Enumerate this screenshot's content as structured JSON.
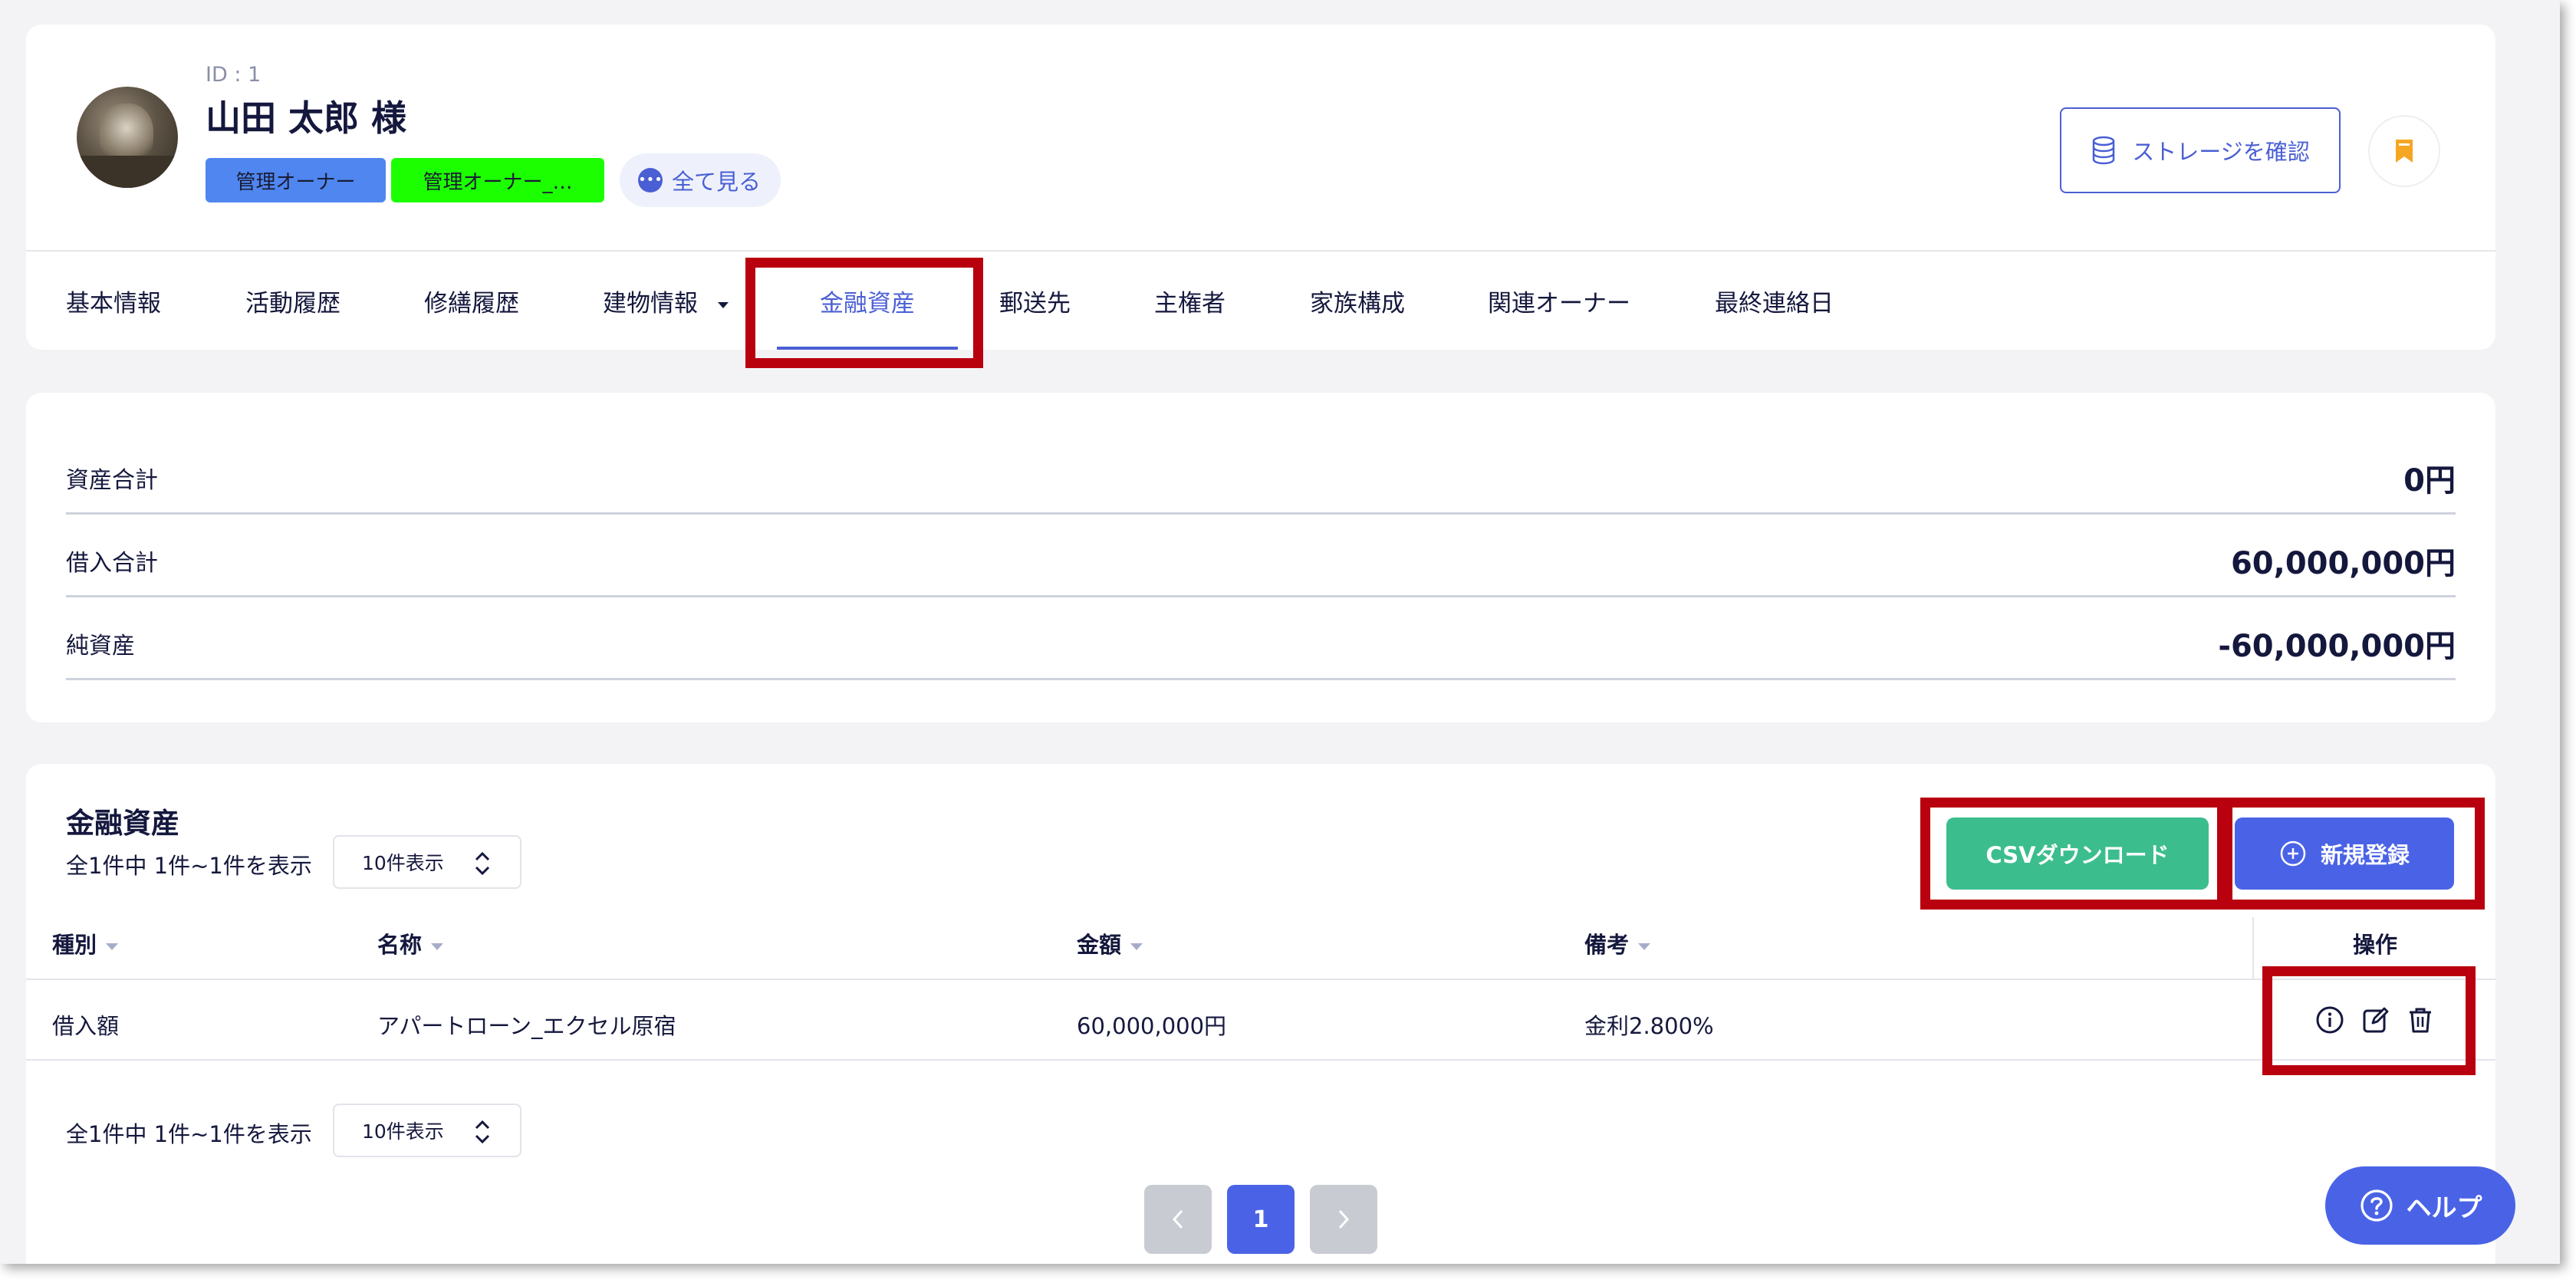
{
  "header": {
    "id_label": "ID : 1",
    "name": "山田 太郎 様",
    "tags": [
      {
        "label": "管理オーナー",
        "color": "#4f86f0"
      },
      {
        "label": "管理オーナー_…",
        "color": "#1cff00"
      }
    ],
    "see_all_label": "全て見る",
    "storage_button_label": "ストレージを確認"
  },
  "tabs": [
    {
      "label": "基本情報"
    },
    {
      "label": "活動履歴"
    },
    {
      "label": "修繕履歴"
    },
    {
      "label": "建物情報"
    },
    {
      "label": "金融資産",
      "active": true
    },
    {
      "label": "郵送先"
    },
    {
      "label": "主権者"
    },
    {
      "label": "家族構成"
    },
    {
      "label": "関連オーナー"
    },
    {
      "label": "最終連絡日"
    }
  ],
  "summary": [
    {
      "label": "資産合計",
      "value": "0円"
    },
    {
      "label": "借入合計",
      "value": "60,000,000円"
    },
    {
      "label": "純資産",
      "value": "-60,000,000円"
    }
  ],
  "assets": {
    "title": "金融資産",
    "count_text": "全1件中 1件~1件を表示",
    "per_page": "10件表示",
    "csv_button_label": "CSVダウンロード",
    "new_button_label": "新規登録",
    "columns": [
      "種別",
      "名称",
      "金額",
      "備考",
      "操作"
    ],
    "rows": [
      [
        "借入額",
        "アパートローン_エクセル原宿",
        "60,000,000円",
        "金利2.800%"
      ]
    ],
    "pagination": {
      "current": "1"
    }
  },
  "help_button_label": "ヘルプ",
  "colors": {
    "accent": "#4a63e6",
    "csv_green": "#3cbd8e",
    "highlight_red": "#b8000f",
    "bookmark_orange": "#f5a623"
  }
}
